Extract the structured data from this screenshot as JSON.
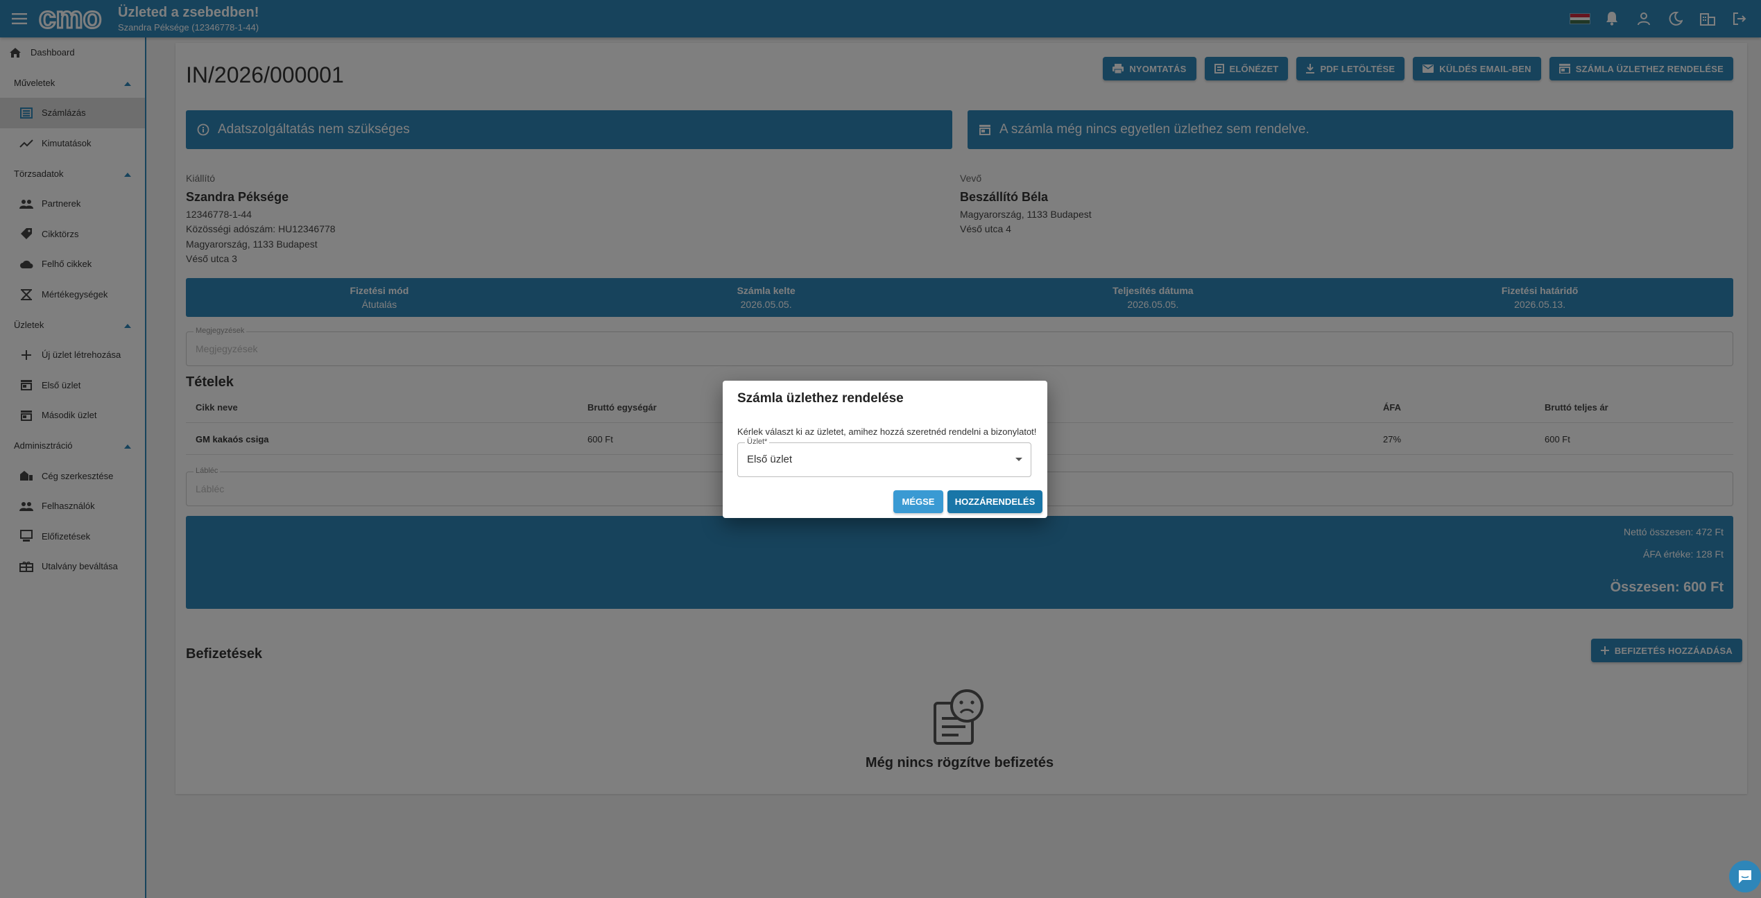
{
  "header": {
    "title": "Üzleted a zsebedben!",
    "subtitle": "Szandra Péksége (12346778-1-44)",
    "logo_text": "cmo"
  },
  "sidebar": {
    "dashboard": "Dashboard",
    "sections": [
      {
        "label": "Műveletek",
        "items": [
          "Számlázás",
          "Kimutatások"
        ]
      },
      {
        "label": "Törzsadatok",
        "items": [
          "Partnerek",
          "Cikktörzs",
          "Felhő cikkek",
          "Mértékegységek"
        ]
      },
      {
        "label": "Üzletek",
        "items": [
          "Új üzlet létrehozása",
          "Első üzlet",
          "Második üzlet"
        ]
      },
      {
        "label": "Adminisztráció",
        "items": [
          "Cég szerkesztése",
          "Felhasználók",
          "Előfizetések",
          "Utalvány beváltása"
        ]
      }
    ]
  },
  "invoice": {
    "number": "IN/2026/000001",
    "actions": [
      "NYOMTATÁS",
      "ELŐNÉZET",
      "PDF LETÖLTÉSE",
      "KÜLDÉS EMAIL-BEN",
      "SZÁMLA ÜZLETHEZ RENDELÉSE"
    ],
    "banner_left": "Adatszolgáltatás nem szükséges",
    "banner_right": "A számla még nincs egyetlen üzlethez sem rendelve.",
    "seller": {
      "label": "Kiállító",
      "name": "Szandra Péksége",
      "lines": [
        "12346778-1-44",
        "Közösségi adószám: HU12346778",
        "Magyarország, 1133 Budapest",
        "Véső utca 3"
      ]
    },
    "buyer": {
      "label": "Vevő",
      "name": "Beszállító Béla",
      "lines": [
        "Magyarország, 1133 Budapest",
        "Véső utca 4"
      ]
    },
    "info": [
      {
        "label": "Fizetési mód",
        "value": "Átutalás"
      },
      {
        "label": "Számla kelte",
        "value": "2026.05.05."
      },
      {
        "label": "Teljesítés dátuma",
        "value": "2026.05.05."
      },
      {
        "label": "Fizetési határidő",
        "value": "2026.05.13."
      }
    ],
    "notes_label": "Megjegyzések",
    "notes_placeholder": "Megjegyzések",
    "items_title": "Tételek",
    "columns": [
      "Cikk neve",
      "Bruttó egységár",
      "ÁFA",
      "Bruttó teljes ár"
    ],
    "rows": [
      {
        "name": "GM kakaós csiga",
        "unit_price": "600 Ft",
        "vat": "27%",
        "total": "600 Ft"
      }
    ],
    "footer_label": "Lábléc",
    "footer_placeholder": "Lábléc",
    "net_total": "Nettó összesen: 472 Ft",
    "vat_total": "ÁFA értéke: 128 Ft",
    "grand_total": "Összesen: 600 Ft",
    "payments_title": "Befizetések",
    "add_payment": "BEFIZETÉS HOZZÁADÁSA",
    "no_payments": "Még nincs rögzítve befizetés"
  },
  "dialog": {
    "title": "Számla üzlethez rendelése",
    "text": "Kérlek választ ki az üzletet, amihez hozzá szeretnéd rendelni a bizonylatot!",
    "select_label": "Üzlet*",
    "select_value": "Első üzlet",
    "cancel": "MÉGSE",
    "confirm": "HOZZÁRENDELÉS"
  },
  "colors": {
    "primary": "#2e86b9",
    "confirm": "#1976a8",
    "cancel": "#3a9ad3"
  }
}
